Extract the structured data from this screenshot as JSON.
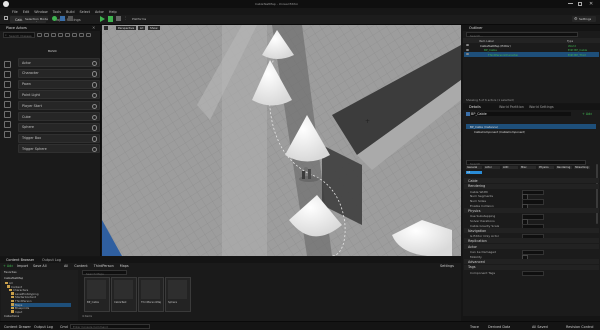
{
  "titlebar": {
    "project_name": "CableTestMap",
    "window_title": "CableTestMap - Unreal Editor"
  },
  "menu": [
    "File",
    "Edit",
    "Window",
    "Tools",
    "Build",
    "Select",
    "Actor",
    "Help"
  ],
  "tabs": {
    "level_tab": "CableTestMap",
    "project_settings_tab": "Project Settings"
  },
  "toolbar": {
    "mode_label": "Selection Mode",
    "platforms_label": "Platforms",
    "settings_label": "Settings"
  },
  "place_actors": {
    "title": "Place Actors",
    "search_placeholder": "Search Classes",
    "category": "BASIC",
    "items": [
      "Actor",
      "Character",
      "Pawn",
      "Point Light",
      "Player Start",
      "Cube",
      "Sphere",
      "Trigger Box",
      "Trigger Sphere"
    ]
  },
  "viewport": {
    "mode_label": "Perspective",
    "lit_label": "Lit",
    "show_label": "Show"
  },
  "outliner": {
    "title": "Outliner",
    "search_placeholder": "Search...",
    "col_item_label": "Item Label",
    "col_type": "Type",
    "rows": [
      {
        "label": "CableTestMap (Editor)",
        "type": "World"
      },
      {
        "label": "BP_Cable",
        "type": "Edit BP_Cable"
      },
      {
        "label": "ThirdPersonCharacter",
        "type": "Edit BP_Third"
      }
    ],
    "footer": "Showing 5 of 6 actors (1 selected)"
  },
  "details": {
    "tabs": [
      "Details",
      "World Partition",
      "World Settings"
    ],
    "actor_name": "BP_Cable",
    "add_label": "+ Add",
    "components": [
      "BP_Cable (Instance)",
      "CableComponent (CableComponent)"
    ],
    "search_placeholder": "Search",
    "filters": [
      "General",
      "Actor",
      "LOD",
      "Misc",
      "Physics",
      "Rendering",
      "Streaming",
      "All"
    ],
    "sections": [
      {
        "title": "Cable",
        "props": []
      },
      {
        "title": "Rendering",
        "props": [
          "Cable Width",
          "Num Segments",
          "Num Sides",
          "Enable Collision"
        ]
      },
      {
        "title": "Physics",
        "props": [
          "Use Substepping",
          "Solver Iterations",
          "Cable Gravity Scale"
        ]
      },
      {
        "title": "Navigation",
        "props": [
          "Is Editor Only Actor"
        ]
      },
      {
        "title": "Replication",
        "props": []
      },
      {
        "title": "Actor",
        "props": [
          "Can be Damaged",
          "Mobility"
        ]
      },
      {
        "title": "Advanced",
        "props": []
      },
      {
        "title": "Tags",
        "props": [
          "Component Tags"
        ]
      }
    ]
  },
  "content_browser": {
    "tab_content": "Content Browser",
    "tab_output": "Output Log",
    "add_label": "+ Add",
    "import_label": "Import",
    "save_all_label": "Save All",
    "settings_label": "Settings",
    "breadcrumb": [
      "All",
      "Content",
      "ThirdPerson",
      "Maps"
    ],
    "favorites_label": "Favorites",
    "project_label": "CableTestMap",
    "folders": [
      "All",
      "Content",
      "Characters",
      "LevelPrototyping",
      "StarterContent",
      "ThirdPerson",
      "Maps",
      "Blueprints",
      "Input"
    ],
    "search_placeholder": "Search Maps",
    "assets": [
      "BP_Cable",
      "CableTest",
      "ThirdPersonMap",
      "Sphere"
    ],
    "collections_label": "Collections",
    "item_count": "4 items"
  },
  "statusbar": {
    "content_drawer": "Content Drawer",
    "output_log": "Output Log",
    "cmd": "Cmd",
    "console_placeholder": "Enter Console Command",
    "trace": "Trace",
    "derived_data": "Derived Data",
    "all_saved": "All Saved",
    "revision_control": "Revision Control"
  },
  "colors": {
    "accent": "#2a8cd6",
    "green": "#3fb34f",
    "selection": "#1e4f7a"
  }
}
